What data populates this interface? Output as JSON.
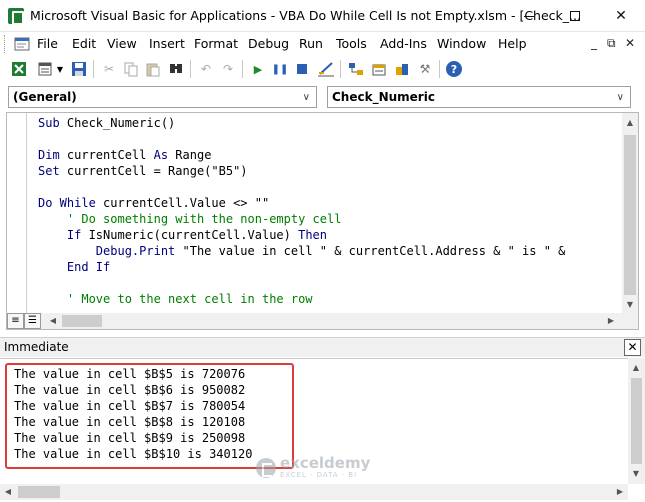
{
  "window": {
    "title": "Microsoft Visual Basic for Applications - VBA Do While Cell Is not Empty.xlsm - [Check_...",
    "minimize": "–",
    "maximize": "☐",
    "close": "✕"
  },
  "menu": {
    "items": [
      "File",
      "Edit",
      "View",
      "Insert",
      "Format",
      "Debug",
      "Run",
      "Tools",
      "Add-Ins",
      "Window",
      "Help"
    ],
    "mdi_min": "_",
    "mdi_restore": "⧉",
    "mdi_close": "✕"
  },
  "toolbar": {
    "icons": [
      "excel-icon",
      "insert-module-icon",
      "dropdown-arrow-icon",
      "save-icon",
      "cut-icon",
      "copy-icon",
      "paste-icon",
      "find-icon",
      "undo-icon",
      "redo-icon",
      "run-icon",
      "break-icon",
      "reset-icon",
      "design-mode-icon",
      "project-explorer-icon",
      "properties-icon",
      "object-browser-icon",
      "toolbox-icon",
      "help-icon"
    ]
  },
  "combos": {
    "object": "(General)",
    "procedure": "Check_Numeric"
  },
  "code": {
    "lines": [
      [
        {
          "t": "Sub ",
          "c": "kw"
        },
        {
          "t": "Check_Numeric()",
          "c": ""
        }
      ],
      [],
      [
        {
          "t": "Dim ",
          "c": "kw"
        },
        {
          "t": "currentCell ",
          "c": ""
        },
        {
          "t": "As ",
          "c": "kw"
        },
        {
          "t": "Range",
          "c": ""
        }
      ],
      [
        {
          "t": "Set ",
          "c": "kw"
        },
        {
          "t": "currentCell = Range(\"B5\")",
          "c": ""
        }
      ],
      [],
      [
        {
          "t": "Do While ",
          "c": "kw"
        },
        {
          "t": "currentCell.Value <> \"\"",
          "c": ""
        }
      ],
      [
        {
          "t": "    ' Do something with the non-empty cell",
          "c": "cm"
        }
      ],
      [
        {
          "t": "    If ",
          "c": "kw"
        },
        {
          "t": "IsNumeric(currentCell.Value) ",
          "c": ""
        },
        {
          "t": "Then",
          "c": "kw"
        }
      ],
      [
        {
          "t": "        Debug.Print ",
          "c": "kw"
        },
        {
          "t": "\"The value in cell \" & currentCell.Address & \" is \" &",
          "c": ""
        }
      ],
      [
        {
          "t": "    End If",
          "c": "kw"
        }
      ],
      [],
      [
        {
          "t": "    ' Move to the next cell in the row",
          "c": "cm"
        }
      ]
    ]
  },
  "immediate": {
    "title": "Immediate",
    "close": "✕",
    "output": [
      "The value in cell $B$5 is 720076",
      "The value in cell $B$6 is 950082",
      "The value in cell $B$7 is 780054",
      "The value in cell $B$8 is 120108",
      "The value in cell $B$9 is 250098",
      "The value in cell $B$10 is 340120"
    ]
  },
  "watermark": {
    "name": "exceldemy",
    "tagline": "EXCEL · DATA · BI"
  },
  "colors": {
    "keyword": "#00007f",
    "comment": "#007f00",
    "highlight": "#e03c3c"
  }
}
